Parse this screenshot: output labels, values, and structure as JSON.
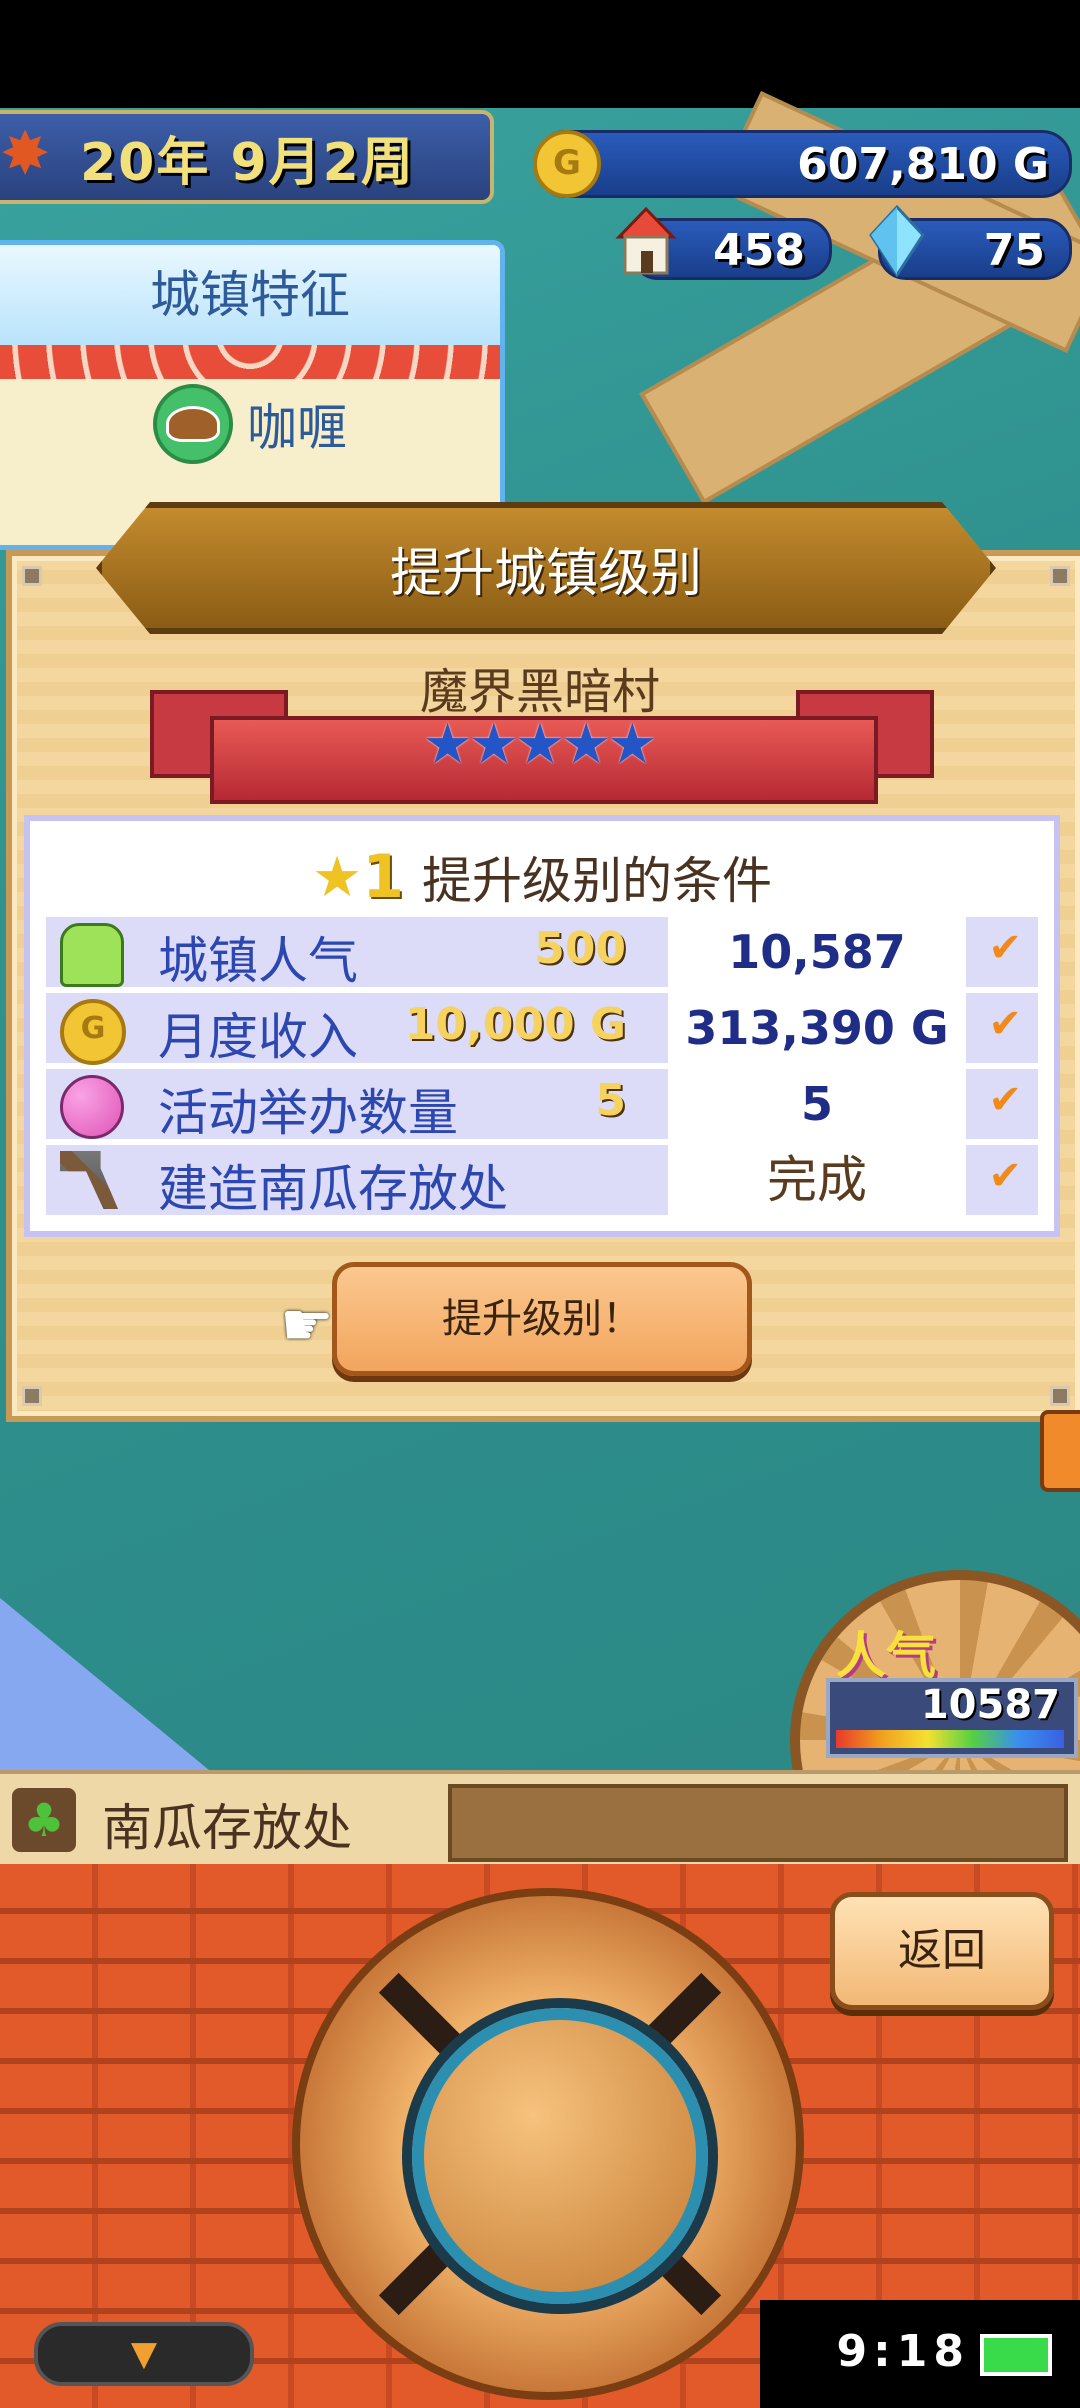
{
  "hud": {
    "date": "20年 9月2周",
    "gold": "607,810 G",
    "coin_symbol": "G",
    "houses": "458",
    "crystals": "75"
  },
  "town_features": {
    "title": "城镇特征",
    "item": "咖喱"
  },
  "dialog": {
    "title": "提升城镇级别",
    "village_name": "魔界黑暗村",
    "stars": 5,
    "condition_level": "1",
    "condition_title": "提升级别的条件",
    "rows": [
      {
        "label": "城镇人气",
        "required": "500",
        "current": "10,587",
        "check": "✔"
      },
      {
        "label": "月度收入",
        "required": "10,000 G",
        "current": "313,390 G",
        "check": "✔"
      },
      {
        "label": "活动举办数量",
        "required": "5",
        "current": "5",
        "check": "✔"
      },
      {
        "label": "建造南瓜存放处",
        "required": "",
        "current": "完成",
        "check": "✔"
      }
    ],
    "button": "提升级别！"
  },
  "popularity": {
    "label": "人气",
    "value": "10587"
  },
  "info_bar": {
    "text": "南瓜存放处"
  },
  "controls": {
    "back": "返回",
    "down_arrow": "▼"
  },
  "status": {
    "time": "9:18"
  },
  "colors": {
    "accent_blue": "#2d47b0",
    "check_orange": "#f08a1a",
    "brick": "#e35a2a"
  }
}
